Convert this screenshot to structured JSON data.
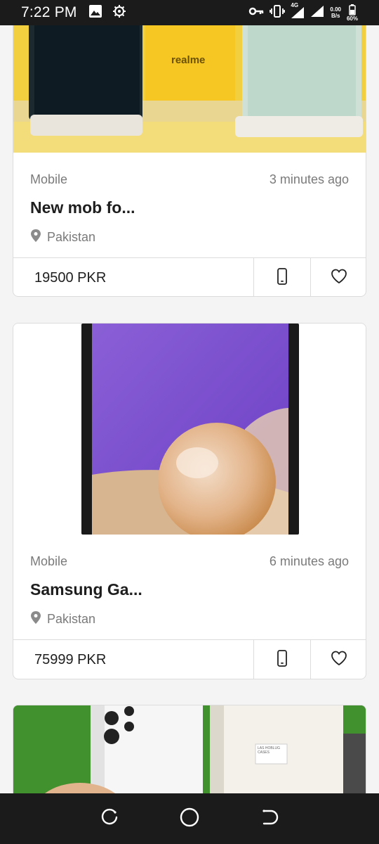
{
  "status_bar": {
    "time": "7:22 PM",
    "network": "4G",
    "net_speed_value": "0.00",
    "net_speed_unit": "B/s",
    "battery": "60%"
  },
  "listings": [
    {
      "category": "Mobile",
      "time_ago": "3 minutes ago",
      "title": "New mob fo...",
      "location": "Pakistan",
      "price": "19500 PKR",
      "image_text": "realme"
    },
    {
      "category": "Mobile",
      "time_ago": "6 minutes ago",
      "title": "Samsung Ga...",
      "location": "Pakistan",
      "price": "75999 PKR"
    },
    {
      "category": "",
      "title": "",
      "image_text": "LAS HOBLUG CASES"
    }
  ],
  "icons": {
    "location": "location-pin-icon",
    "call": "phone-icon",
    "favorite": "heart-icon",
    "nav_recent": "recent-apps-icon",
    "nav_home": "home-icon",
    "nav_back": "back-icon"
  },
  "colors": {
    "status_bar": "#1b1b1b",
    "card_border": "#dcdcdc",
    "text_primary": "#1e1e1e",
    "text_secondary": "#7a7a7a"
  }
}
